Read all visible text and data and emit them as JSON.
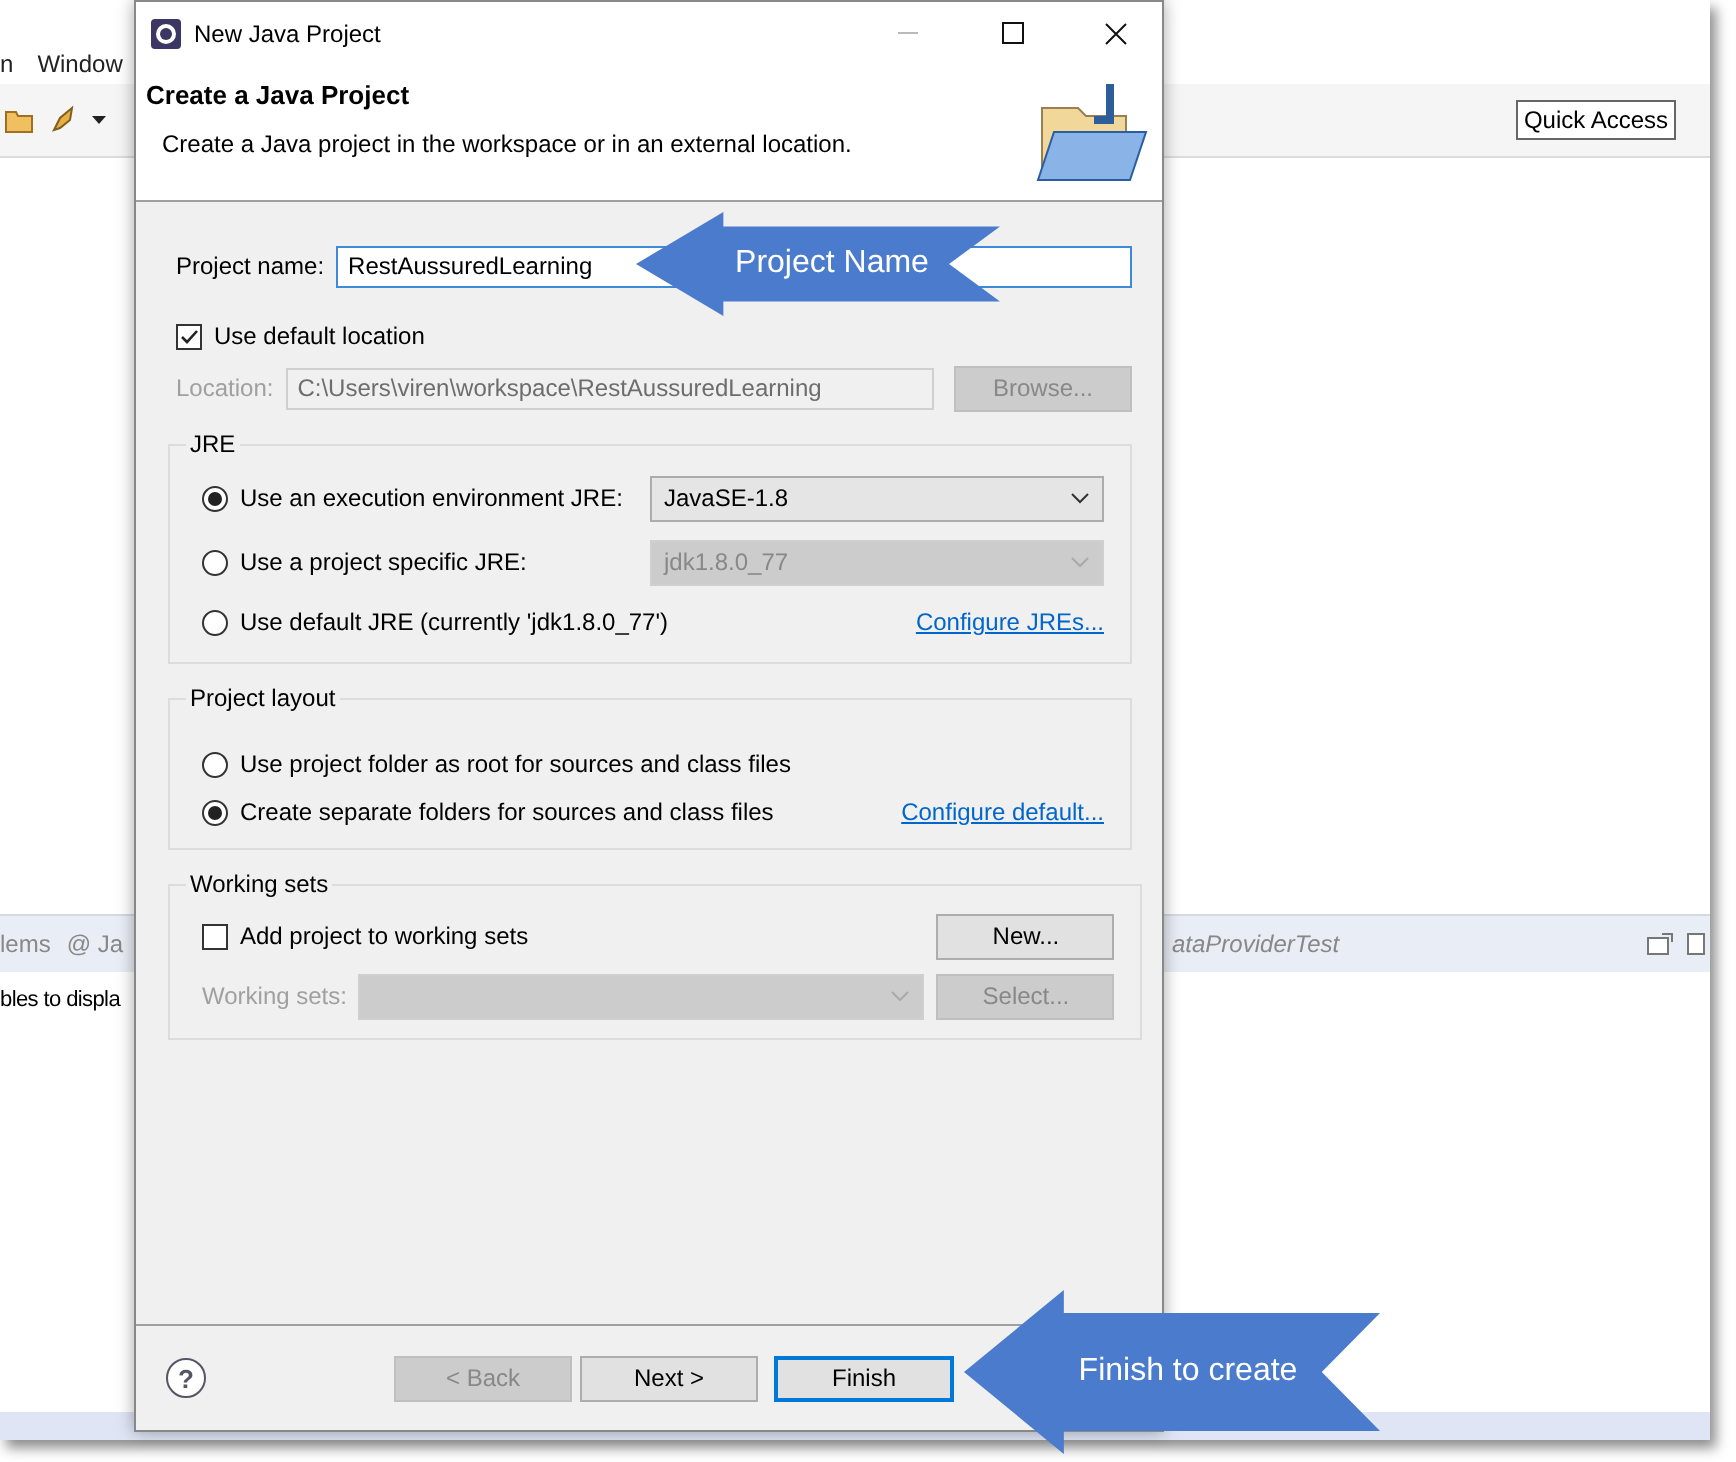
{
  "background_window": {
    "menu": [
      "n",
      "Window"
    ],
    "quick_access": "Quick Access",
    "panel_tabs": [
      {
        "label": "lems"
      },
      {
        "label": "@ Ja"
      }
    ],
    "editor_tab": "ataProviderTest",
    "panel_text": "bles to displa"
  },
  "dialog": {
    "title": "New Java Project",
    "header": {
      "title": "Create a Java Project",
      "description": "Create a Java project in the workspace or in an external location."
    },
    "project_name": {
      "label": "Project name:",
      "value": "RestAussuredLearning"
    },
    "use_default_location": {
      "label": "Use default location",
      "checked": true
    },
    "location": {
      "label": "Location:",
      "value": "C:\\Users\\viren\\workspace\\RestAussuredLearning",
      "disabled": true,
      "button": "Browse..."
    },
    "jre": {
      "legend": "JRE",
      "options": [
        {
          "label": "Use an execution environment JRE:",
          "selected": true,
          "select": {
            "value": "JavaSE-1.8",
            "disabled": false
          }
        },
        {
          "label": "Use a project specific JRE:",
          "selected": false,
          "select": {
            "value": "jdk1.8.0_77",
            "disabled": true
          }
        },
        {
          "label": "Use default JRE (currently 'jdk1.8.0_77')",
          "selected": false,
          "link": "Configure JREs..."
        }
      ]
    },
    "project_layout": {
      "legend": "Project layout",
      "options": [
        {
          "label": "Use project folder as root for sources and class files",
          "selected": false
        },
        {
          "label": "Create separate folders for sources and class files",
          "selected": true,
          "link": "Configure default..."
        }
      ]
    },
    "working_sets": {
      "legend": "Working sets",
      "add": {
        "label": "Add project to working sets",
        "checked": false
      },
      "new_button": {
        "label": "New...",
        "disabled": false
      },
      "sets": {
        "label": "Working sets:",
        "disabled": true
      },
      "select_button": {
        "label": "Select...",
        "disabled": true
      }
    },
    "help_button": "?",
    "buttons": [
      {
        "label": "< Back",
        "disabled": true,
        "default": false
      },
      {
        "label": "Next >",
        "disabled": false,
        "default": false
      },
      {
        "label": "Finish",
        "disabled": false,
        "default": true
      }
    ]
  },
  "callouts": [
    {
      "text": "Project Name"
    },
    {
      "text": "Finish to create"
    }
  ]
}
